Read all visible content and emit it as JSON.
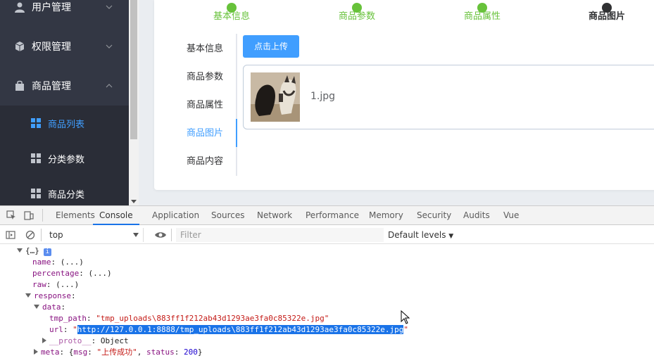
{
  "sidebar": {
    "items": [
      {
        "label": "用户管理",
        "icon": "user-icon"
      },
      {
        "label": "权限管理",
        "icon": "cube-icon"
      },
      {
        "label": "商品管理",
        "icon": "shopping-bag-icon"
      }
    ],
    "sub_items": [
      {
        "label": "商品列表",
        "icon": "grid-icon",
        "active": true
      },
      {
        "label": "分类参数",
        "icon": "grid-icon",
        "active": false
      },
      {
        "label": "商品分类",
        "icon": "grid-icon",
        "active": false
      }
    ]
  },
  "steps": [
    "基本信息",
    "商品参数",
    "商品属性",
    "商品图片"
  ],
  "tabs": [
    "基本信息",
    "商品参数",
    "商品属性",
    "商品图片",
    "商品内容"
  ],
  "upload": {
    "button_label": "点击上传",
    "file_name": "1.jpg"
  },
  "devtools": {
    "tabs": [
      "Elements",
      "Console",
      "Application",
      "Sources",
      "Network",
      "Performance",
      "Memory",
      "Security",
      "Audits",
      "Vue"
    ],
    "active_tab": "Console",
    "context": "top",
    "filter_placeholder": "Filter",
    "levels": "Default levels"
  },
  "console": {
    "root": "{…}",
    "name_key": "name",
    "percentage_key": "percentage",
    "raw_key": "raw",
    "collapsed": "(...)",
    "response_key": "response",
    "data_key": "data",
    "tmp_path_key": "tmp_path",
    "tmp_path_value": "\"tmp_uploads\\883ff1f212ab43d1293ae3fa0c85322e.jpg\"",
    "url_key": "url",
    "url_value": "http://127.0.0.1:8888/tmp_uploads\\883ff1f212ab43d1293ae3fa0c85322e.jpg",
    "proto_key": "__proto__",
    "proto_value": "Object",
    "meta_key": "meta",
    "meta_msg_key": "msg",
    "meta_msg_value": "\"上传成功\"",
    "meta_status_key": "status",
    "meta_status_value": "200"
  },
  "colors": {
    "sidebar_bg": "#333744",
    "accent": "#409eff",
    "step_done": "#67c23a"
  }
}
